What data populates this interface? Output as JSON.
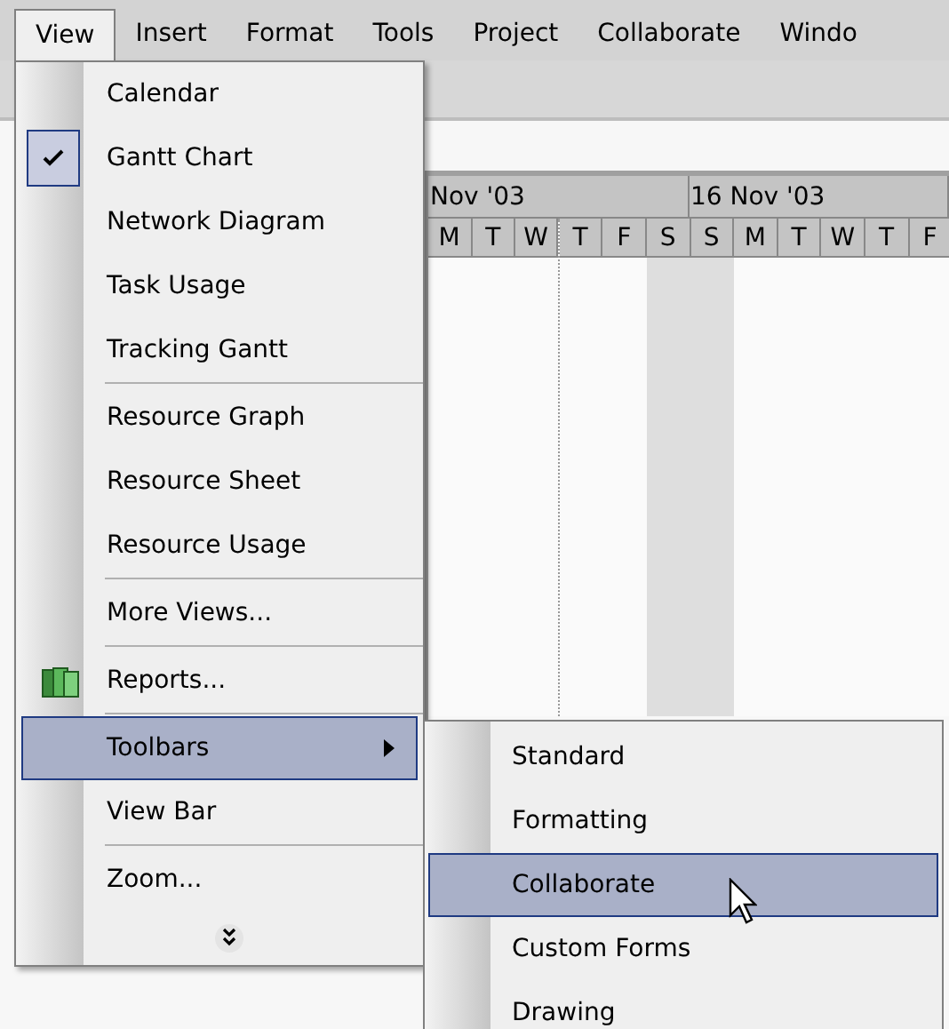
{
  "menu_bar": [
    {
      "label": "View",
      "selected": true
    },
    {
      "label": "Insert",
      "selected": false
    },
    {
      "label": "Format",
      "selected": false
    },
    {
      "label": "Tools",
      "selected": false
    },
    {
      "label": "Project",
      "selected": false
    },
    {
      "label": "Collaborate",
      "selected": false
    },
    {
      "label": "Windo",
      "selected": false
    }
  ],
  "view_menu": [
    {
      "kind": "item",
      "label": "Calendar",
      "checked": false,
      "selected": false
    },
    {
      "kind": "item",
      "label": "Gantt Chart",
      "checked": true,
      "selected": false
    },
    {
      "kind": "item",
      "label": "Network Diagram",
      "checked": false,
      "selected": false
    },
    {
      "kind": "item",
      "label": "Task Usage",
      "checked": false,
      "selected": false
    },
    {
      "kind": "item",
      "label": "Tracking Gantt",
      "checked": false,
      "selected": false
    },
    {
      "kind": "separator"
    },
    {
      "kind": "item",
      "label": "Resource Graph",
      "checked": false,
      "selected": false
    },
    {
      "kind": "item",
      "label": "Resource Sheet",
      "checked": false,
      "selected": false
    },
    {
      "kind": "item",
      "label": "Resource Usage",
      "checked": false,
      "selected": false
    },
    {
      "kind": "separator"
    },
    {
      "kind": "item",
      "label": "More Views...",
      "checked": false,
      "selected": false
    },
    {
      "kind": "separator"
    },
    {
      "kind": "icon_item",
      "label": "Reports...",
      "checked": false,
      "selected": false
    },
    {
      "kind": "separator"
    },
    {
      "kind": "submenu",
      "label": "Toolbars",
      "checked": false,
      "selected": true
    },
    {
      "kind": "item",
      "label": "View Bar",
      "checked": false,
      "selected": false
    },
    {
      "kind": "separator"
    },
    {
      "kind": "item",
      "label": "Zoom...",
      "checked": false,
      "selected": false
    },
    {
      "kind": "expand"
    }
  ],
  "toolbars_submenu": [
    {
      "label": "Standard",
      "selected": false
    },
    {
      "label": "Formatting",
      "selected": false
    },
    {
      "label": "Collaborate",
      "selected": true
    },
    {
      "label": "Custom Forms",
      "selected": false
    },
    {
      "label": "Drawing",
      "selected": false
    }
  ],
  "gantt": {
    "periods": [
      {
        "label": "Nov '03",
        "days": [
          {
            "label": "M",
            "weekend": false
          },
          {
            "label": "T",
            "weekend": false
          },
          {
            "label": "W",
            "weekend": false
          },
          {
            "label": "T",
            "weekend": false
          },
          {
            "label": "F",
            "weekend": false
          },
          {
            "label": "S",
            "weekend": true
          }
        ]
      },
      {
        "label": "16 Nov '03",
        "days": [
          {
            "label": "S",
            "weekend": true
          },
          {
            "label": "M",
            "weekend": false
          },
          {
            "label": "T",
            "weekend": false
          },
          {
            "label": "W",
            "weekend": false
          },
          {
            "label": "T",
            "weekend": false
          },
          {
            "label": "F",
            "weekend": false
          }
        ]
      }
    ]
  }
}
